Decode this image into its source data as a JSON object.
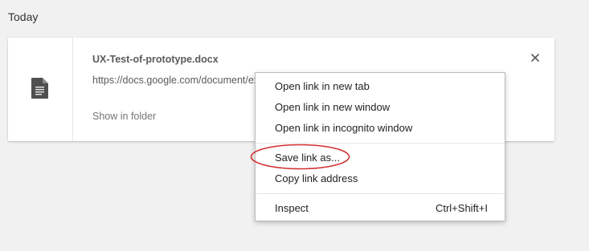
{
  "section": {
    "title": "Today"
  },
  "download": {
    "file_name": "UX-Test-of-prototype.docx",
    "url": "https://docs.google.com/document/export?format=docx",
    "show_in_folder_label": "Show in folder",
    "file_icon": "document-icon",
    "close_icon": "close-icon"
  },
  "context_menu": {
    "items": [
      {
        "label": "Open link in new tab"
      },
      {
        "label": "Open link in new window"
      },
      {
        "label": "Open link in incognito window"
      },
      {
        "label": "Save link as..."
      },
      {
        "label": "Copy link address"
      },
      {
        "label": "Inspect",
        "shortcut": "Ctrl+Shift+I"
      }
    ]
  },
  "annotation": {
    "shape": "ellipse",
    "color": "#d32f2f",
    "target": "Save link as..."
  }
}
